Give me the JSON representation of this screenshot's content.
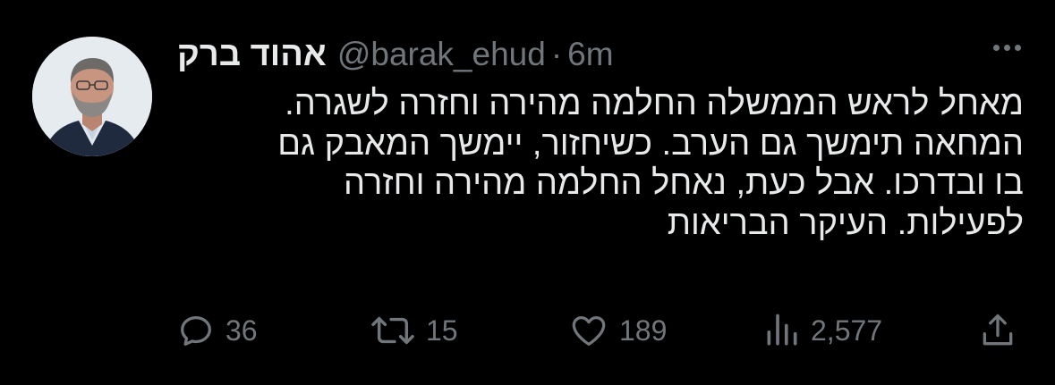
{
  "tweet": {
    "author": {
      "display_name": "אהוד ברק",
      "handle": "@barak_ehud",
      "avatar_icon": "profile-photo"
    },
    "separator": "·",
    "time": "6m",
    "more_icon": "more-horizontal-icon",
    "lines": [
      "מאחל לראש הממשלה החלמה מהירה וחזרה לשגרה.",
      "המחאה תימשך גם הערב. כשיחזור, יימשך המאבק גם",
      "בו ובדרכו. אבל כעת, נאחל החלמה מהירה וחזרה",
      "לפעילות. העיקר הבריאות"
    ],
    "actions": {
      "reply": {
        "icon": "reply-icon",
        "count": "36"
      },
      "retweet": {
        "icon": "retweet-icon",
        "count": "15"
      },
      "like": {
        "icon": "heart-icon",
        "count": "189"
      },
      "views": {
        "icon": "views-icon",
        "count": "2,577"
      },
      "share": {
        "icon": "share-icon"
      }
    }
  },
  "colors": {
    "background": "#000000",
    "text_primary": "#e7e9ea",
    "text_secondary": "#71767b"
  }
}
